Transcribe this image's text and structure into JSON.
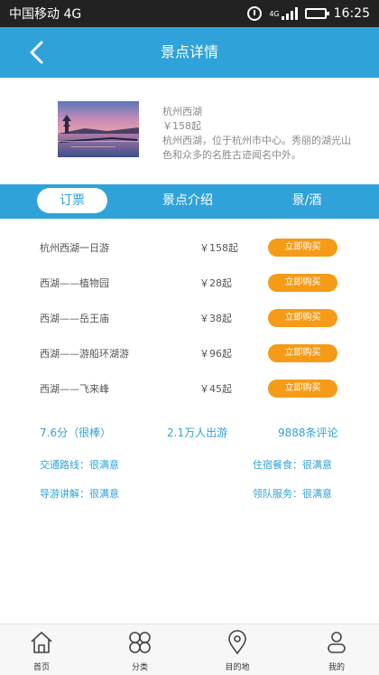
{
  "status_bar": {
    "carrier": "中国移动 4G",
    "network_tag": "4G",
    "time": "16:25",
    "battery_level": 0.35
  },
  "header": {
    "title": "景点详情",
    "back_icon": "chevron-left-icon"
  },
  "spot": {
    "name": "杭州西湖",
    "price": "￥158起",
    "description": "杭州西湖，位于杭州市中心。秀丽的湖光山色和众多的名胜古迹闻名中外。"
  },
  "tabs": [
    {
      "label": "订票",
      "active": true
    },
    {
      "label": "景点介绍",
      "active": false
    },
    {
      "label": "景/酒",
      "active": false
    }
  ],
  "tickets": [
    {
      "name": "杭州西湖一日游",
      "price": "￥158起",
      "button": "立即购买"
    },
    {
      "name": "西湖——植物园",
      "price": "￥28起",
      "button": "立即购买"
    },
    {
      "name": "西湖——岳王庙",
      "price": "￥38起",
      "button": "立即购买"
    },
    {
      "name": "西湖——游船环湖游",
      "price": "￥96起",
      "button": "立即购买"
    },
    {
      "name": "西湖——飞来峰",
      "price": "￥45起",
      "button": "立即购买"
    }
  ],
  "stats": {
    "score": "7.6分（很棒）",
    "visitors": "2.1万人出游",
    "reviews": "9888条评论"
  },
  "ratings": {
    "traffic": "交通路线：很满意",
    "lodging": "住宿餐食：很满意",
    "guide": "导游讲解：很满意",
    "leader": "领队服务：很满意"
  },
  "bottom_nav": [
    {
      "label": "首页",
      "icon": "home-icon"
    },
    {
      "label": "分类",
      "icon": "category-icon"
    },
    {
      "label": "目的地",
      "icon": "location-pin-icon"
    },
    {
      "label": "我的",
      "icon": "user-icon"
    }
  ],
  "colors": {
    "primary": "#2fa2d9",
    "buy_button": "#f59b17",
    "status_bar": "#222222"
  }
}
